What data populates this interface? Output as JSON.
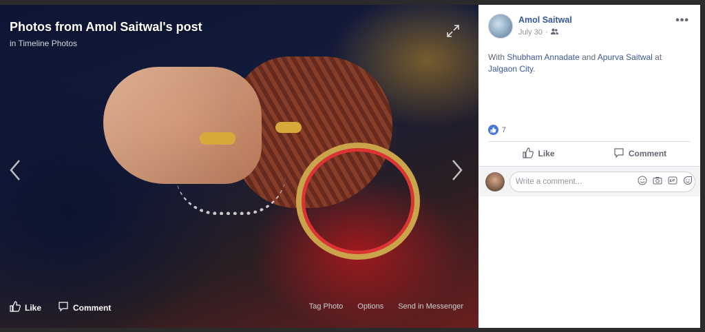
{
  "photo": {
    "title": "Photos from Amol Saitwal's post",
    "subtitle": "in Timeline Photos",
    "actions": {
      "like": "Like",
      "comment": "Comment"
    },
    "links": [
      "Tag Photo",
      "Options",
      "Send in Messenger"
    ]
  },
  "post": {
    "author": "Amol Saitwal",
    "date": "July 30",
    "audience_icon": "friends-icon",
    "content": {
      "prefix": "With ",
      "person1": "Shubham Annadate",
      "and": " and ",
      "person2": "Apurva Saitwal",
      "at": " at ",
      "place": "Jalgaon City",
      "suffix": "."
    },
    "like_count": "7",
    "actions": {
      "like": "Like",
      "comment": "Comment"
    },
    "comment_placeholder": "Write a comment...",
    "more_label": "•••"
  }
}
